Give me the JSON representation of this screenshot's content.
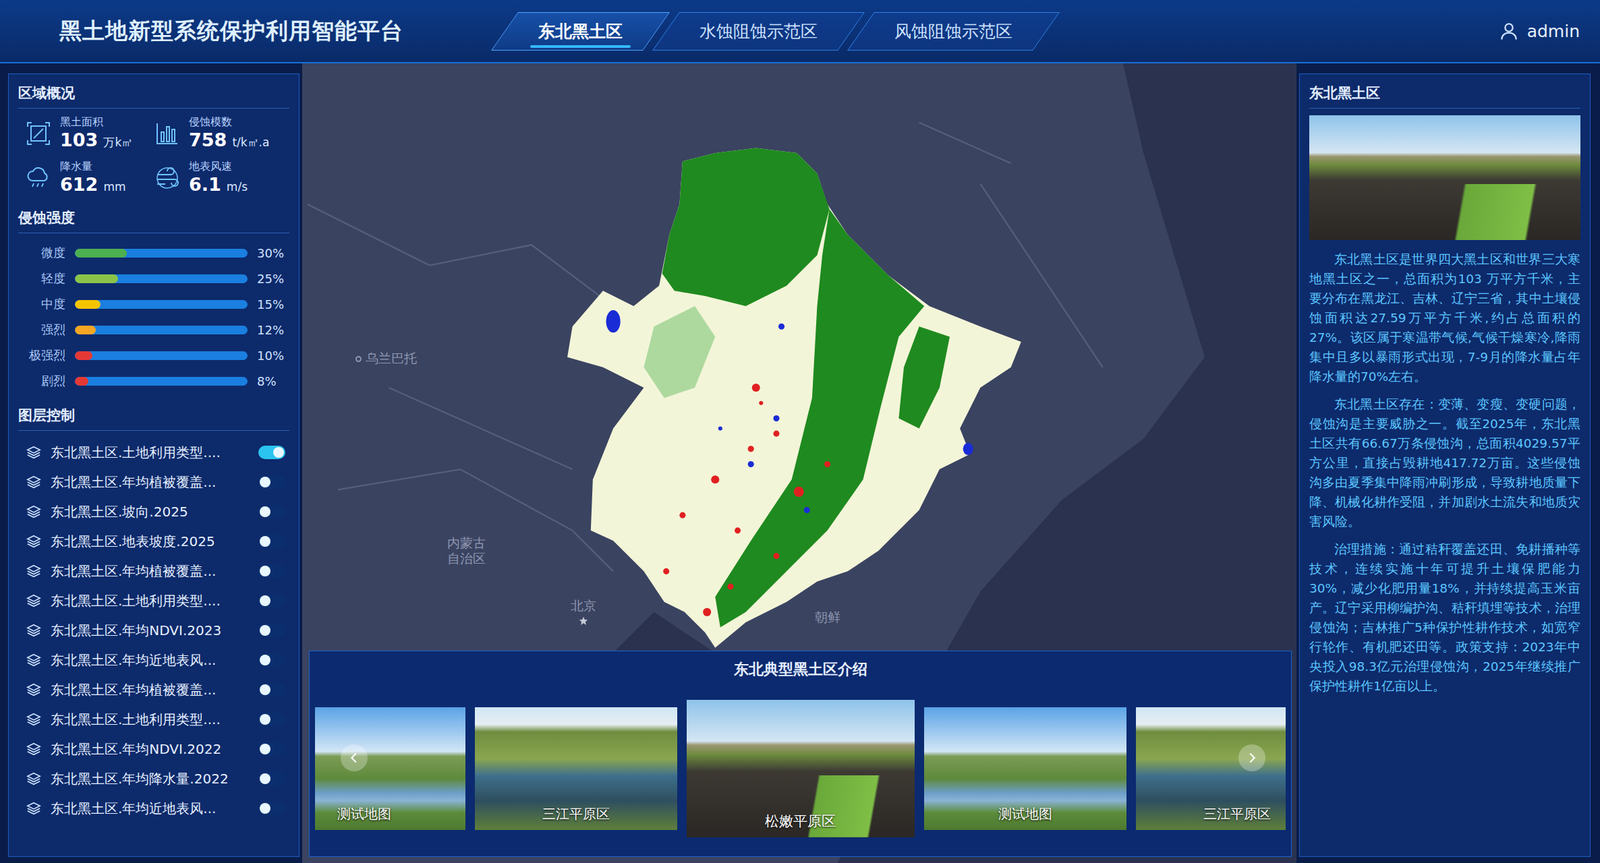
{
  "header": {
    "title": "黑土地新型系统保护利用智能平台",
    "tabs": [
      {
        "label": "东北黑土区",
        "selected": true
      },
      {
        "label": "水蚀阻蚀示范区",
        "selected": false
      },
      {
        "label": "风蚀阻蚀示范区",
        "selected": false
      }
    ],
    "user": "admin"
  },
  "overview": {
    "title": "区域概况",
    "stats": [
      {
        "kind": "area",
        "label": "黑土面积",
        "value": "103",
        "unit": "万k㎡"
      },
      {
        "kind": "modulus",
        "label": "侵蚀模数",
        "value": "758",
        "unit": "t/k㎡.a"
      },
      {
        "kind": "rain",
        "label": "降水量",
        "value": "612",
        "unit": "mm"
      },
      {
        "kind": "wind",
        "label": "地表风速",
        "value": "6.1",
        "unit": "m/s"
      }
    ]
  },
  "erosion": {
    "title": "侵蚀强度",
    "bars": [
      {
        "label": "微度",
        "level": 0.3,
        "reading": "30%",
        "color": "#4caf50"
      },
      {
        "label": "轻度",
        "level": 0.25,
        "reading": "25%",
        "color": "#8bc34a"
      },
      {
        "label": "中度",
        "level": 0.15,
        "reading": "15%",
        "color": "#f5c400"
      },
      {
        "label": "强烈",
        "level": 0.12,
        "reading": "12%",
        "color": "#f5a623"
      },
      {
        "label": "极强烈",
        "level": 0.1,
        "reading": "10%",
        "color": "#e53935"
      },
      {
        "label": "剧烈",
        "level": 0.08,
        "reading": "8%",
        "color": "#e53935"
      }
    ]
  },
  "layers": {
    "title": "图层控制",
    "items": [
      {
        "label": "东北黑土区.土地利用类型....",
        "on": true
      },
      {
        "label": "东北黑土区.年均植被覆盖...",
        "on": false
      },
      {
        "label": "东北黑土区.坡向.2025",
        "on": false
      },
      {
        "label": "东北黑土区.地表坡度.2025",
        "on": false
      },
      {
        "label": "东北黑土区.年均植被覆盖...",
        "on": false
      },
      {
        "label": "东北黑土区.土地利用类型....",
        "on": false
      },
      {
        "label": "东北黑土区.年均NDVI.2023",
        "on": false
      },
      {
        "label": "东北黑土区.年均近地表风...",
        "on": false
      },
      {
        "label": "东北黑土区.年均植被覆盖...",
        "on": false
      },
      {
        "label": "东北黑土区.土地利用类型....",
        "on": false
      },
      {
        "label": "东北黑土区.年均NDVI.2022",
        "on": false
      },
      {
        "label": "东北黑土区.年均降水量.2022",
        "on": false
      },
      {
        "label": "东北黑土区.年均近地表风...",
        "on": false
      }
    ]
  },
  "map": {
    "labels": [
      {
        "text": "乌兰巴托",
        "kind": "city"
      },
      {
        "text": "内蒙古自治区",
        "kind": "region"
      },
      {
        "text": "北京",
        "kind": "capital"
      },
      {
        "text": "朝鲜",
        "kind": "country"
      }
    ]
  },
  "intro": {
    "title": "东北黑土区",
    "paragraphs": [
      "东北黑土区是世界四大黑土区和世界三大寒地黑土区之一，总面积为103 万平方千米，主要分布在黑龙江、吉林、辽宁三省，其中土壤侵蚀面积达27.59万平方千米,约占总面积的27%。该区属于寒温带气候,气候干燥寒冷,降雨集中且多以暴雨形式出现，7-9月的降水量占年降水量的70%左右。",
      "东北黑土区存在：变薄、变瘦、变硬问题，侵蚀沟是主要威胁之一。截至2025年，东北黑土区共有66.67万条侵蚀沟，总面积4029.57平方公里，直接占毁耕地417.72万亩。这些侵蚀沟多由夏季集中降雨冲刷形成，导致耕地质量下降、机械化耕作受阻，并加剧水土流失和地质灾害风险。",
      "治理措施：通过秸秆覆盖还田、免耕播种等技术，连续实施十年可提升土壤保肥能力30%，减少化肥用量18%，并持续提高玉米亩产。辽宁采用柳编护沟、秸秆填埋等技术，治理侵蚀沟；吉林推广5种保护性耕作技术，如宽窄行轮作、有机肥还田等。政策支持：2023年中央投入98.3亿元治理侵蚀沟，2025年继续推广保护性耕作1亿亩以上。"
    ]
  },
  "carousel": {
    "title": "东北典型黑土区介绍",
    "cards": [
      {
        "label": "测试地图",
        "selected": false
      },
      {
        "label": "三江平原区",
        "selected": false
      },
      {
        "label": "松嫩平原区",
        "selected": true
      },
      {
        "label": "测试地图",
        "selected": false
      },
      {
        "label": "三江平原区",
        "selected": false
      }
    ]
  }
}
